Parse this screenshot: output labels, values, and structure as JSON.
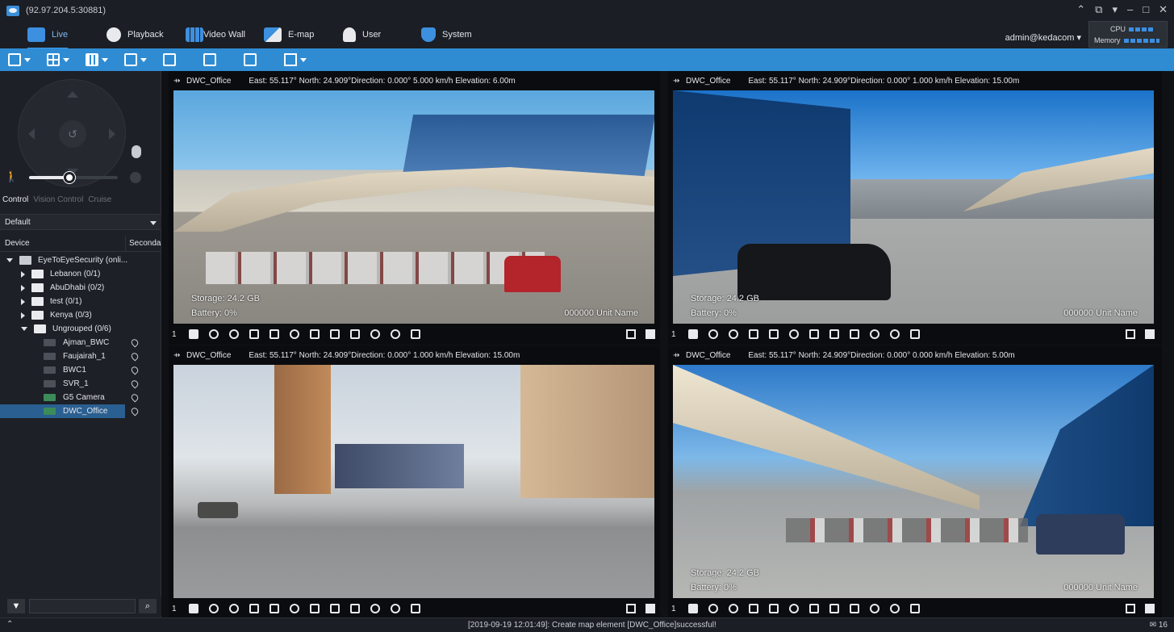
{
  "window": {
    "title": "(92.97.204.5:30881)"
  },
  "nav": {
    "items": [
      {
        "label": "Live"
      },
      {
        "label": "Playback"
      },
      {
        "label": "Video Wall"
      },
      {
        "label": "E-map"
      },
      {
        "label": "User"
      },
      {
        "label": "System"
      }
    ],
    "user": "admin@kedacom",
    "cpu_label": "CPU",
    "memory_label": "Memory"
  },
  "control": {
    "tabs": [
      "Control",
      "Vision Control",
      "Cruise"
    ],
    "preset": "Default",
    "speed_level": 0.45
  },
  "tree": {
    "col_device": "Device",
    "col_secondary": "Seconda",
    "root": "EyeToEyeSecurity (onli...",
    "groups": [
      {
        "label": "Lebanon (0/1)"
      },
      {
        "label": "AbuDhabi (0/2)"
      },
      {
        "label": "test (0/1)"
      },
      {
        "label": "Kenya (0/3)"
      },
      {
        "label": "Ungrouped (0/6)"
      }
    ],
    "devices": [
      {
        "label": "Ajman_BWC"
      },
      {
        "label": "Faujairah_1"
      },
      {
        "label": "BWC1"
      },
      {
        "label": "SVR_1"
      },
      {
        "label": "G5 Camera"
      },
      {
        "label": "DWC_Office"
      }
    ],
    "search_placeholder": ""
  },
  "tiles": [
    {
      "name": "DWC_Office",
      "gps": "East: 55.117° North: 24.909°Direction: 0.000° 5.000 km/h Elevation: 6.00m",
      "storage": "Storage: 24.2 GB",
      "battery": "Battery: 0%",
      "unit": "000000 Unit Name",
      "index": "1"
    },
    {
      "name": "DWC_Office",
      "gps": "East: 55.117° North: 24.909°Direction: 0.000° 1.000 km/h Elevation: 15.00m",
      "storage": "Storage: 24.2 GB",
      "battery": "Battery: 0%",
      "unit": "000000 Unit Name",
      "index": "1"
    },
    {
      "name": "DWC_Office",
      "gps": "East: 55.117° North: 24.909°Direction: 0.000° 1.000 km/h Elevation: 15.00m",
      "storage": "",
      "battery": "",
      "unit": "",
      "index": "1"
    },
    {
      "name": "DWC_Office",
      "gps": "East: 55.117° North: 24.909°Direction: 0.000° 0.000 km/h Elevation: 5.00m",
      "storage": "Storage: 24.2 GB",
      "battery": "Battery: 0%",
      "unit": "000000 Unit Name",
      "index": "1"
    }
  ],
  "status": {
    "message": "[2019-09-19 12:01:49]: Create map element [DWC_Office]successful!",
    "count": "16"
  },
  "colors": {
    "accent": "#2f8cd3",
    "selected": "#2a5f91",
    "background": "#0f1115"
  }
}
